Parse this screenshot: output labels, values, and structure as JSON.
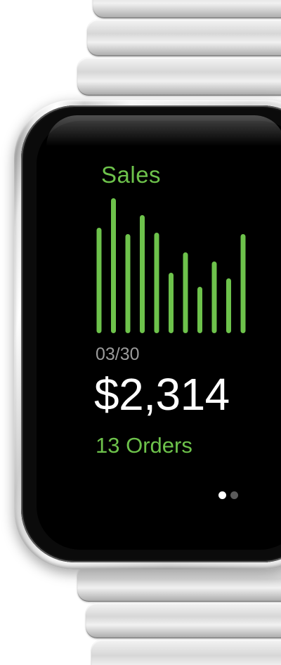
{
  "app": {
    "title": "Sales"
  },
  "chart_data": {
    "type": "bar",
    "bar_color": "#6dc24b",
    "values": [
      150,
      192,
      141,
      168,
      143,
      86,
      115,
      66,
      102,
      78,
      141
    ],
    "title": "Sales",
    "xlabel": "",
    "ylabel": "",
    "ylim": [
      0,
      200
    ],
    "grid": false
  },
  "summary": {
    "date": "03/30",
    "amount": "$2,314",
    "orders": "13 Orders"
  },
  "pager": {
    "page_count": 2,
    "active_index": 0,
    "active_color": "#ffffff",
    "inactive_color": "#5a5a5a"
  },
  "colors": {
    "accent": "#6dc24b",
    "screen_background": "#000000",
    "amount_text": "#ffffff",
    "date_text": "#9b9b9b"
  }
}
